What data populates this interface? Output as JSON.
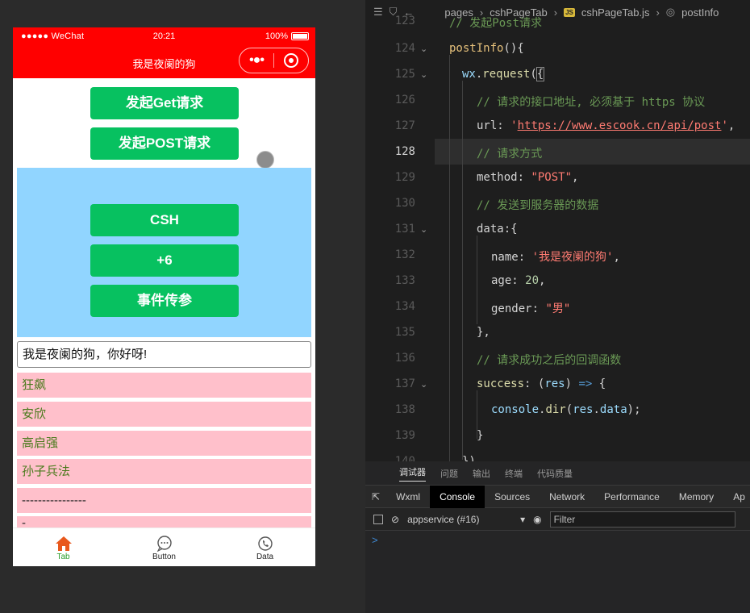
{
  "simulator": {
    "status": {
      "carrier": "●●●●● WeChat",
      "time": "20:21",
      "battery": "100%"
    },
    "nav": {
      "title": "我是夜阑的狗"
    },
    "buttons": {
      "get": "发起Get请求",
      "post": "发起POST请求",
      "csh": "CSH",
      "plus6": "+6",
      "event": "事件传参"
    },
    "greeting": "我是夜阑的狗，你好呀!",
    "list": [
      "狂飙",
      "安欣",
      "高启强",
      "孙子兵法",
      "----------------",
      "-"
    ],
    "tabbar": [
      {
        "label": "Tab",
        "icon": "home-icon"
      },
      {
        "label": "Button",
        "icon": "chat-icon"
      },
      {
        "label": "Data",
        "icon": "phone-icon"
      }
    ]
  },
  "editor": {
    "breadcrumb": [
      "pages",
      "cshPageTab",
      "cshPageTab.js",
      "postInfo"
    ],
    "line_numbers": [
      "123",
      "124",
      "125",
      "126",
      "127",
      "128",
      "129",
      "130",
      "131",
      "132",
      "133",
      "134",
      "135",
      "136",
      "137",
      "138",
      "139",
      "140"
    ],
    "current_line": "128"
  },
  "panel": {
    "top_tabs": [
      "调试器",
      "问题",
      "输出",
      "终端",
      "代码质量"
    ],
    "devtools_tabs": [
      "Wxml",
      "Console",
      "Sources",
      "Network",
      "Performance",
      "Memory",
      "Ap"
    ],
    "context": "appservice (#16)",
    "filter_placeholder": "Filter",
    "prompt": ">"
  },
  "colors": {
    "navbar": "#ff0000",
    "button": "#07c160",
    "blue_panel": "#91d5ff",
    "list_item": "#ffc0cb"
  }
}
